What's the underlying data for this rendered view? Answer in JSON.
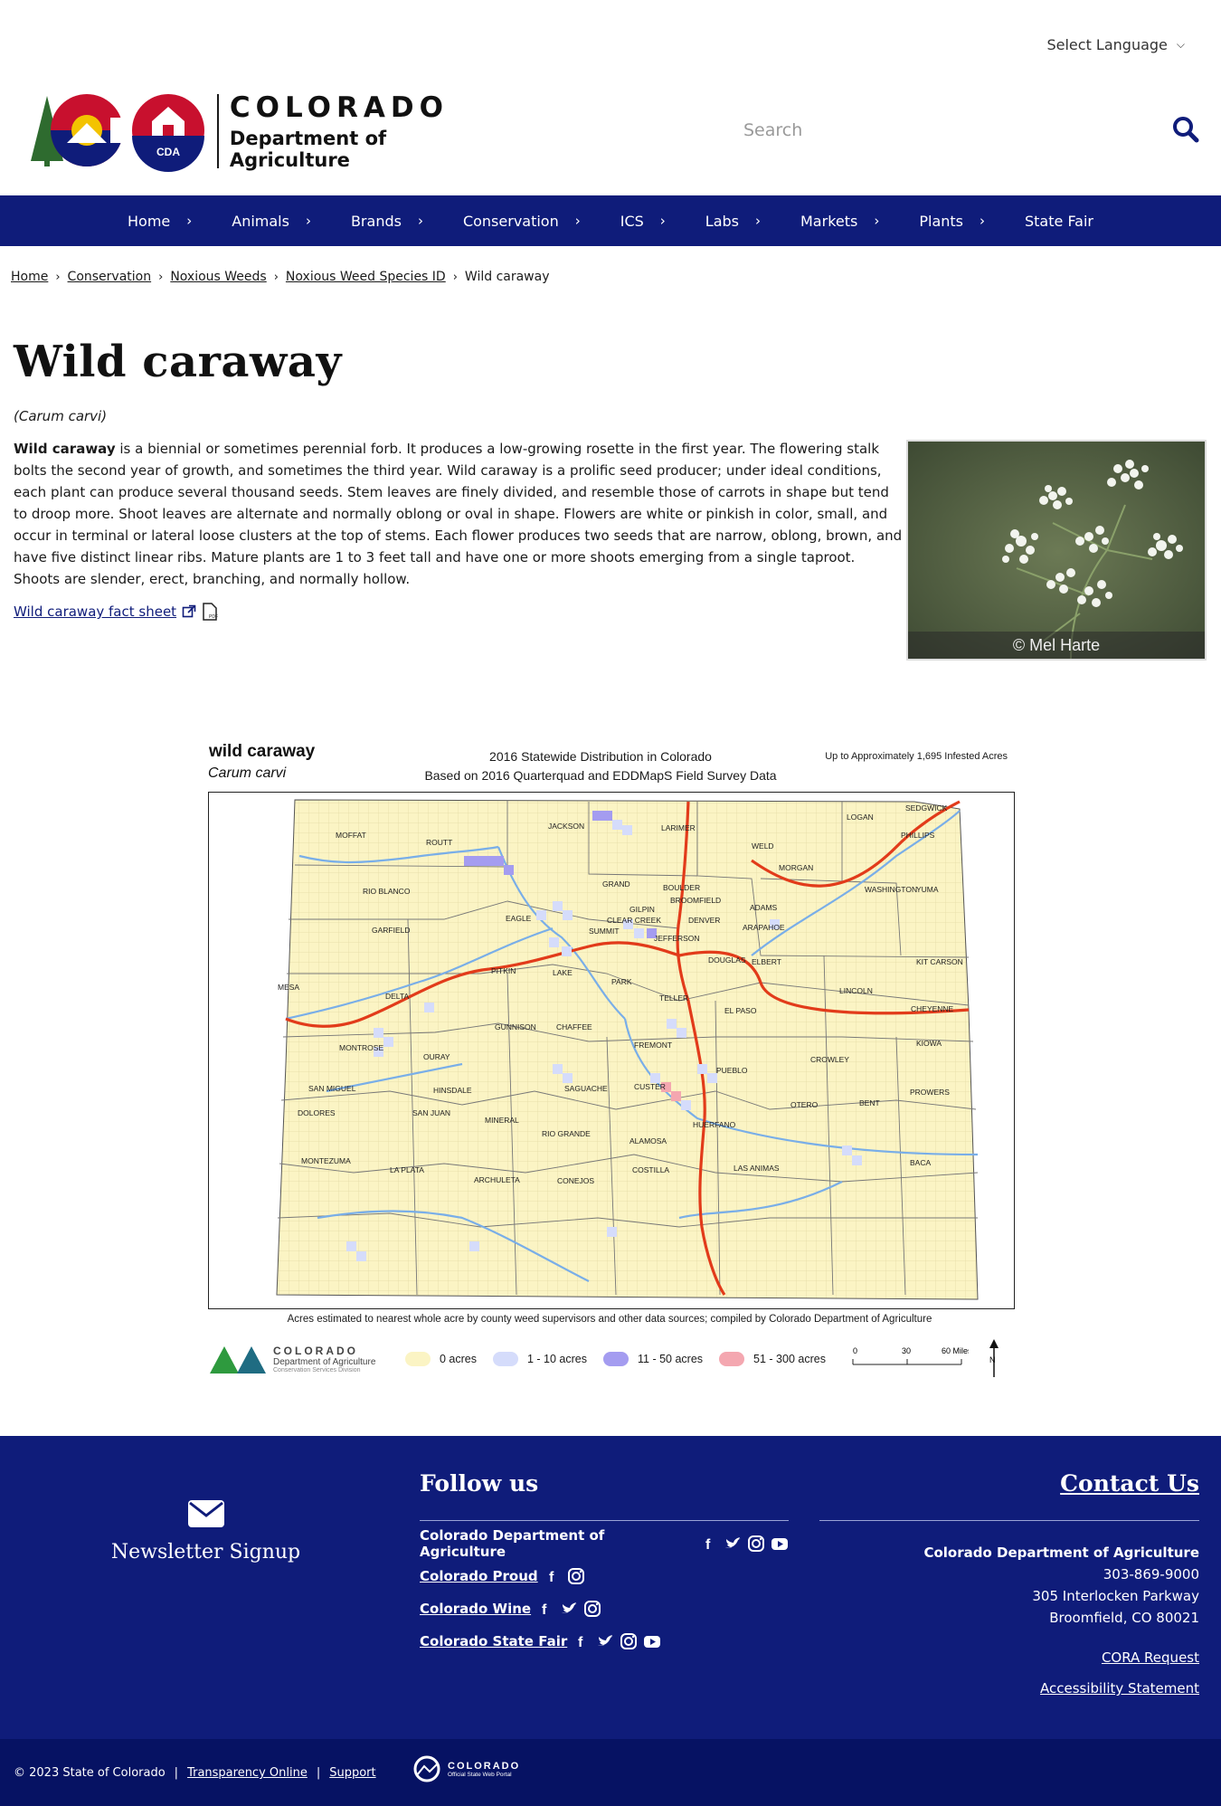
{
  "language": {
    "label": "Select Language"
  },
  "brand": {
    "wordmark_top": "COLORADO",
    "wordmark_bottom": "Department of Agriculture",
    "cda_badge": "CDA",
    "colors": {
      "navy": "#0f1c7a",
      "red": "#c8102e",
      "gold": "#f3c300",
      "green": "#2e6b2f"
    }
  },
  "search": {
    "placeholder": "Search",
    "icon": "search-icon"
  },
  "nav": {
    "items": [
      {
        "label": "Home"
      },
      {
        "label": "Animals"
      },
      {
        "label": "Brands"
      },
      {
        "label": "Conservation"
      },
      {
        "label": "ICS"
      },
      {
        "label": "Labs"
      },
      {
        "label": "Markets"
      },
      {
        "label": "Plants"
      },
      {
        "label": "State Fair"
      }
    ]
  },
  "breadcrumb": {
    "items": [
      "Home",
      "Conservation",
      "Noxious Weeds",
      "Noxious Weed Species ID"
    ],
    "current": "Wild caraway"
  },
  "page": {
    "title": "Wild caraway",
    "scientific_name": "(Carum carvi)",
    "lead_bold": "Wild caraway",
    "body": " is a biennial or sometimes perennial forb. It produces a low-growing rosette in the first year. The flowering stalk bolts the second year of growth, and sometimes the third year. Wild caraway is a prolific seed producer; under ideal conditions, each plant can produce several thousand seeds. Stem leaves are finely divided, and resemble those of carrots in shape but tend to droop more. Shoot leaves are alternate and normally oblong or oval in shape. Flowers are white or pinkish in color, small, and occur in terminal or lateral loose clusters at the top of stems. Each flower produces two seeds that are narrow, oblong, brown, and have five distinct linear ribs. Mature plants are 1 to 3 feet tall and have one or more shoots emerging from a single taproot. Shoots are slender, erect, branching, and normally hollow.",
    "fact_sheet_label": "Wild caraway fact sheet",
    "photo_credit": "© Mel Harte"
  },
  "map": {
    "common_name": "wild caraway",
    "scientific_name": "Carum carvi",
    "title_line1": "2016 Statewide Distribution in Colorado",
    "title_line2": "Based on 2016 Quarterquad and EDDMapS Field Survey Data",
    "infested": "Up to Approximately 1,695 Infested Acres",
    "note": "Acres estimated to nearest whole acre by county weed supervisors and other data sources; compiled by Colorado Department of Agriculture",
    "counties": [
      "MOFFAT",
      "ROUTT",
      "JACKSON",
      "LARIMER",
      "LOGAN",
      "SEDGWICK",
      "PHILLIPS",
      "WELD",
      "MORGAN",
      "RIO BLANCO",
      "GRAND",
      "BOULDER",
      "BROOMFIELD",
      "WASHINGTON",
      "YUMA",
      "GARFIELD",
      "EAGLE",
      "GILPIN",
      "CLEAR CREEK",
      "DENVER",
      "ADAMS",
      "SUMMIT",
      "JEFFERSON",
      "ARAPAHOE",
      "PITKIN",
      "LAKE",
      "DOUGLAS",
      "ELBERT",
      "KIT CARSON",
      "MESA",
      "PARK",
      "DELTA",
      "TELLER",
      "LINCOLN",
      "EL PASO",
      "CHEYENNE",
      "GUNNISON",
      "CHAFFEE",
      "MONTROSE",
      "FREMONT",
      "KIOWA",
      "OURAY",
      "CROWLEY",
      "SAN MIGUEL",
      "HINSDALE",
      "SAGUACHE",
      "CUSTER",
      "PUEBLO",
      "OTERO",
      "BENT",
      "PROWERS",
      "DOLORES",
      "SAN JUAN",
      "MINERAL",
      "HUERFANO",
      "RIO GRANDE",
      "ALAMOSA",
      "MONTEZUMA",
      "LA PLATA",
      "ARCHULETA",
      "CONEJOS",
      "COSTILLA",
      "LAS ANIMAS",
      "BACA"
    ],
    "legend": {
      "org_line1": "COLORADO",
      "org_line2": "Department of Agriculture",
      "org_line3": "Conservation Services Division",
      "items": [
        {
          "label": "0 acres",
          "color": "#fbf4c4"
        },
        {
          "label": "1 - 10 acres",
          "color": "#d5dcfb"
        },
        {
          "label": "11 - 50 acres",
          "color": "#a49cf0"
        },
        {
          "label": "51 - 300 acres",
          "color": "#f4a7b0"
        }
      ],
      "scale_ticks": [
        "0",
        "30",
        "60 Miles"
      ],
      "north": "N"
    }
  },
  "footer": {
    "newsletter": "Newsletter Signup",
    "follow_title": "Follow us",
    "follow_rows": [
      {
        "label": "Colorado Department of Agriculture",
        "icons": [
          "facebook-icon",
          "twitter-icon",
          "instagram-icon",
          "youtube-icon"
        ]
      },
      {
        "label": "Colorado Proud",
        "icons": [
          "facebook-icon",
          "instagram-icon"
        ]
      },
      {
        "label": "Colorado Wine",
        "icons": [
          "facebook-icon",
          "twitter-icon",
          "instagram-icon"
        ]
      },
      {
        "label": "Colorado State Fair",
        "icons": [
          "facebook-icon",
          "twitter-icon",
          "instagram-icon",
          "youtube-icon"
        ]
      }
    ],
    "contact_title": "Contact Us",
    "contact_org": "Colorado Department of Agriculture",
    "contact_phone": "303-869-9000",
    "contact_street": "305 Interlocken Parkway",
    "contact_city": "Broomfield, CO 80021",
    "cora": "CORA Request",
    "accessibility": "Accessibility Statement"
  },
  "bottom": {
    "copyright": "© 2023 State of Colorado",
    "sep": "|",
    "transparency": "Transparency Online",
    "support": "Support",
    "portal_line1": "COLORADO",
    "portal_line2": "Official State Web Portal"
  }
}
